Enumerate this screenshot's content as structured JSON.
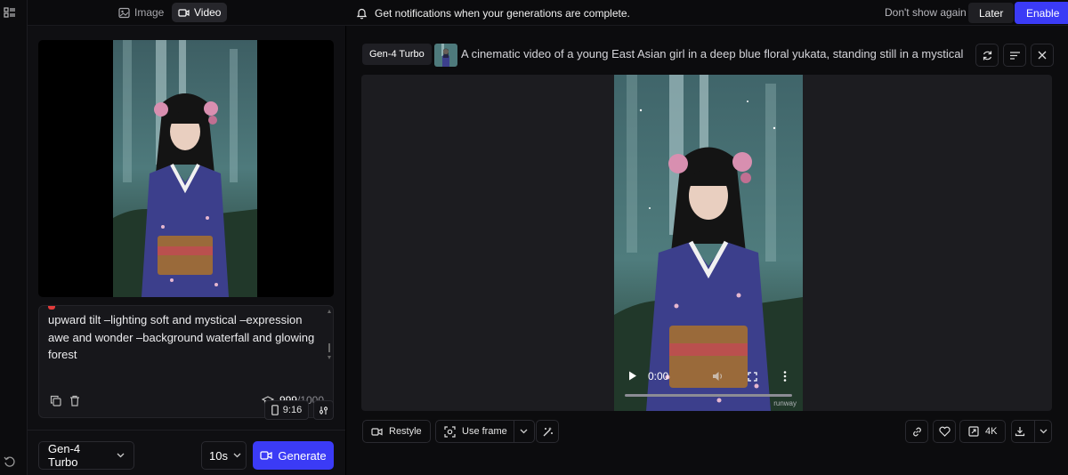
{
  "topbar": {
    "tabs": [
      {
        "label": "Image",
        "icon": "image-icon"
      },
      {
        "label": "Video",
        "icon": "video-icon",
        "active": true
      }
    ],
    "notification": "Get notifications when your generations are complete.",
    "dont_show_label": "Don't show again",
    "later_label": "Later",
    "enable_label": "Enable"
  },
  "left": {
    "prompt_text": "upward tilt –lighting soft and mystical –expression awe and wonder –background waterfall and glowing forest",
    "char_count": "999",
    "char_limit": "/1000",
    "aspect_label": "9:16",
    "model_label": "Gen-4 Turbo",
    "duration_label": "10s",
    "generate_label": "Generate"
  },
  "right": {
    "model_chip": "Gen-4 Turbo",
    "prompt_title": "A cinematic video of a young East Asian girl in a deep blue floral yukata, standing still in a mystical f...",
    "video_time": "0:00",
    "watermark": "runway",
    "restyle_label": "Restyle",
    "use_frame_label": "Use frame",
    "resolution_label": "4K"
  },
  "colors": {
    "accent": "#3b3bf6",
    "panel_bg": "#0f0f12",
    "stage_bg": "#1c1c20"
  }
}
